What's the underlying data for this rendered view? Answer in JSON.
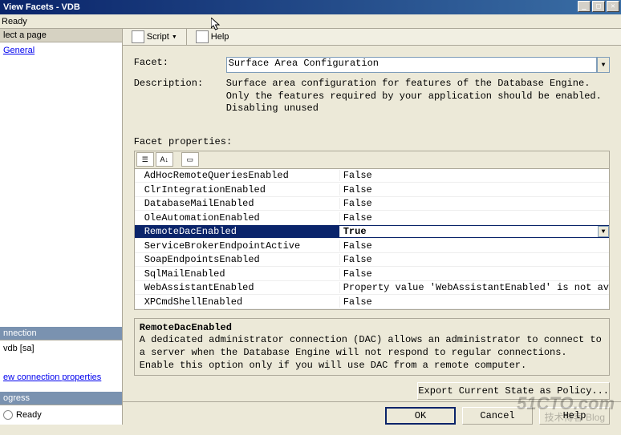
{
  "window": {
    "title": "View Facets - VDB",
    "status_top": "Ready",
    "buttons": {
      "min": "_",
      "max": "□",
      "close": "✕"
    }
  },
  "sidebar": {
    "select_page_header": "lect a page",
    "general_link": "General",
    "connection_header": "nnection",
    "connection_text": "vdb [sa]",
    "view_conn_link": "ew connection properties",
    "progress_header": "ogress",
    "progress_text": "Ready"
  },
  "toolbar": {
    "script_label": "Script",
    "help_label": "Help"
  },
  "form": {
    "facet_label": "Facet:",
    "facet_value": "Surface Area Configuration",
    "description_label": "Description:",
    "description_text": "Surface area configuration for features of the Database Engine. Only the features required by your application should be enabled. Disabling unused",
    "properties_label": "Facet properties:"
  },
  "properties": [
    {
      "name": "AdHocRemoteQueriesEnabled",
      "value": "False",
      "selected": false
    },
    {
      "name": "ClrIntegrationEnabled",
      "value": "False",
      "selected": false
    },
    {
      "name": "DatabaseMailEnabled",
      "value": "False",
      "selected": false
    },
    {
      "name": "OleAutomationEnabled",
      "value": "False",
      "selected": false
    },
    {
      "name": "RemoteDacEnabled",
      "value": "True",
      "selected": true
    },
    {
      "name": "ServiceBrokerEndpointActive",
      "value": "False",
      "selected": false
    },
    {
      "name": "SoapEndpointsEnabled",
      "value": "False",
      "selected": false
    },
    {
      "name": "SqlMailEnabled",
      "value": "False",
      "selected": false
    },
    {
      "name": "WebAssistantEnabled",
      "value": "Property value 'WebAssistantEnabled' is not av",
      "selected": false
    },
    {
      "name": "XPCmdShellEnabled",
      "value": "False",
      "selected": false
    }
  ],
  "help": {
    "title": "RemoteDacEnabled",
    "text": "A dedicated administrator connection (DAC) allows an administrator to connect to a server when the Database Engine will not respond to regular connections. Enable this option only if you will use DAC from a remote computer."
  },
  "buttons": {
    "export": "Export Current State as Policy...",
    "ok": "OK",
    "cancel": "Cancel",
    "help": "Help"
  },
  "watermark": {
    "main": "51CTO.com",
    "sub": "技术博客 Blog"
  }
}
